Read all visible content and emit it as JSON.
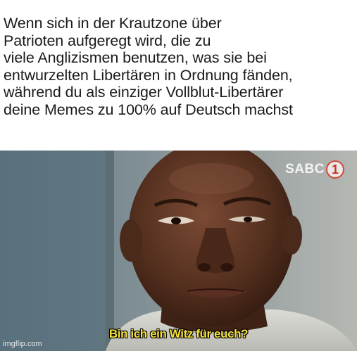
{
  "caption": {
    "lines": [
      "Wenn sich in der Krautzone über",
      "Patrioten aufgeregt wird, die zu",
      "viele Anglizismen benutzen, was sie bei",
      "entwurzelten Libertären in Ordnung fänden,",
      "während du als einziger Vollblut-Libertärer",
      "deine Memes zu 100% auf Deutsch machst"
    ]
  },
  "photo": {
    "channel_logo_text": "SABC",
    "channel_logo_number": "1",
    "subtitle": "Bin ich ein Witz für euch?",
    "watermark": "imgflip.com"
  },
  "colors": {
    "subtitle": "#f7e23a",
    "logo_accent": "#c8331f",
    "caption_text": "#1a1a1a"
  }
}
